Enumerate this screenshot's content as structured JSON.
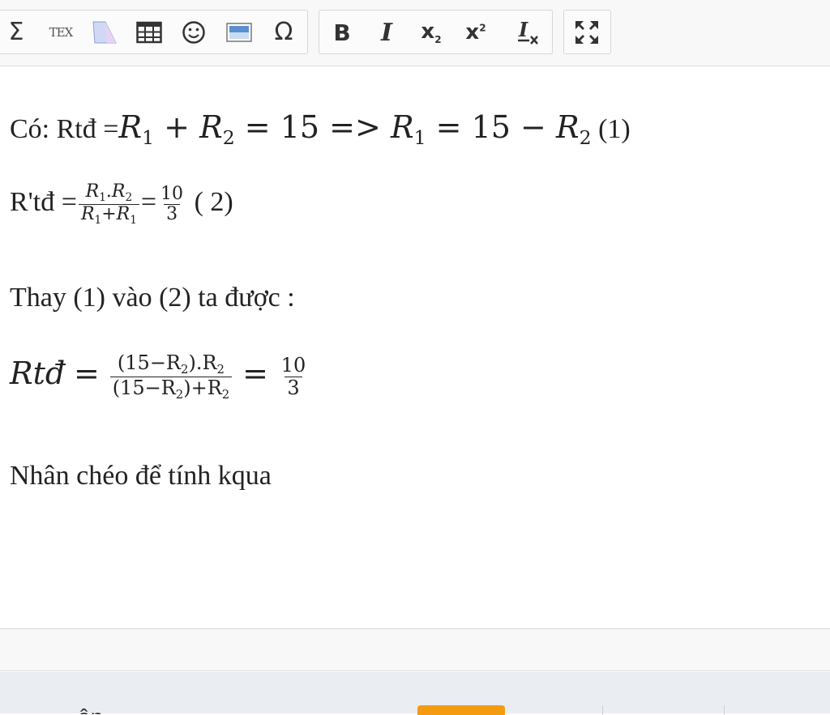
{
  "toolbar": {
    "groups": [
      {
        "name": "insert",
        "buttons": [
          {
            "name": "sigma",
            "glyph": "Σ"
          },
          {
            "name": "tex",
            "glyph": "TEX"
          },
          {
            "name": "shape",
            "glyph": ""
          },
          {
            "name": "table",
            "glyph": ""
          },
          {
            "name": "emoji",
            "glyph": "☺"
          },
          {
            "name": "image",
            "glyph": ""
          },
          {
            "name": "omega",
            "glyph": "Ω"
          }
        ]
      },
      {
        "name": "format",
        "buttons": [
          {
            "name": "bold",
            "glyph": "B"
          },
          {
            "name": "italic",
            "glyph": "I"
          },
          {
            "name": "subscript",
            "glyph": "x"
          },
          {
            "name": "superscript",
            "glyph": "x"
          },
          {
            "name": "remove-format",
            "glyph": "I"
          }
        ]
      },
      {
        "name": "view",
        "buttons": [
          {
            "name": "maximize",
            "glyph": ""
          }
        ]
      }
    ]
  },
  "content": {
    "line1": {
      "prefix": "Có: Rtđ =",
      "r1": "R",
      "r1_sub": "1",
      "plus": "+",
      "r2": "R",
      "r2_sub": "2",
      "eq1": "=",
      "fifteen": "15",
      "arrow": "=>",
      "r1b": "R",
      "r1b_sub": "1",
      "eq2": "=",
      "fifteen_b": "15",
      "minus": "−",
      "r2b": "R",
      "r2b_sub": "2",
      "tag": "(1)"
    },
    "line2": {
      "prefix": "R'tđ =",
      "num_r1": "R",
      "num_r1_sub": "1",
      "num_dot": ".",
      "num_r2": "R",
      "num_r2_sub": "2",
      "den_r1": "R",
      "den_r1_sub": "1",
      "den_plus": "+",
      "den_r2": "R",
      "den_r2_sub": "1",
      "eq": "=",
      "val_num": "10",
      "val_den": "3",
      "tag": "( 2)"
    },
    "line3": {
      "text": "Thay (1) vào (2) ta được :"
    },
    "line4": {
      "lhs": "Rtđ",
      "eq1": "=",
      "num": "(15−R",
      "num_sub": "2",
      "num_tail": ").R",
      "num_tail_sub": "2",
      "den": "(15−R",
      "den_sub": "2",
      "den_tail": ")+R",
      "den_tail_sub": "2",
      "eq2": "=",
      "val_num": "10",
      "val_den": "3"
    },
    "line5": {
      "text": "Nhân chéo để tính kqua"
    }
  },
  "footer": {
    "partial_label": "ân",
    "colors": {
      "accent_tab": "#f39c12"
    }
  }
}
